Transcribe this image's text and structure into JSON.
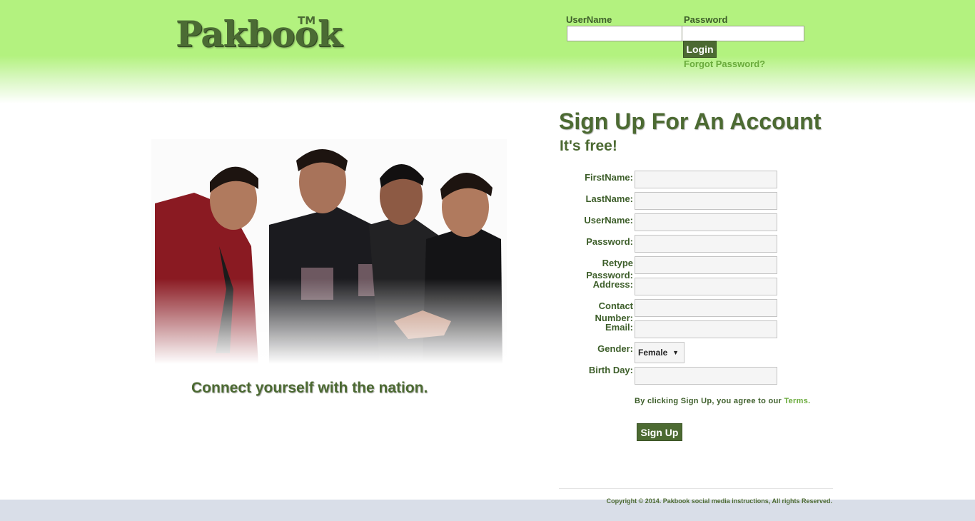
{
  "header": {
    "logo": "Pakbook",
    "logo_tm": "TM",
    "username_label": "UserName",
    "password_label": "Password",
    "username_value": "",
    "password_value": "",
    "login_label": "Login",
    "forgot_label": "Forgot Password?"
  },
  "hero": {
    "tagline": "Connect yourself with the nation."
  },
  "signup": {
    "title": "Sign Up For An Account",
    "subtitle": "It's free!",
    "fields": {
      "first_name": "FirstName:",
      "last_name": "LastName:",
      "user_name": "UserName:",
      "password": "Password:",
      "retype_password_line1": "Retype",
      "retype_password_line2": "Password:",
      "address": "Address:",
      "contact_line1": "Contact",
      "contact_line2": "Number:",
      "email": "Email:",
      "gender": "Gender:",
      "birth_day": "Birth Day:"
    },
    "gender_selected": "Female",
    "terms_text": "By clicking Sign Up, you agree to our ",
    "terms_link": "Terms.",
    "button_label": "Sign Up"
  },
  "footer": {
    "copyright": "Copyright © 2014. Pakbook social media instructions, All rights Reserved."
  },
  "colors": {
    "header_green": "#b3f27f",
    "brand_dark_green": "#4c6a32",
    "link_green": "#6aab3c",
    "footer_bar": "#d9dee8"
  }
}
